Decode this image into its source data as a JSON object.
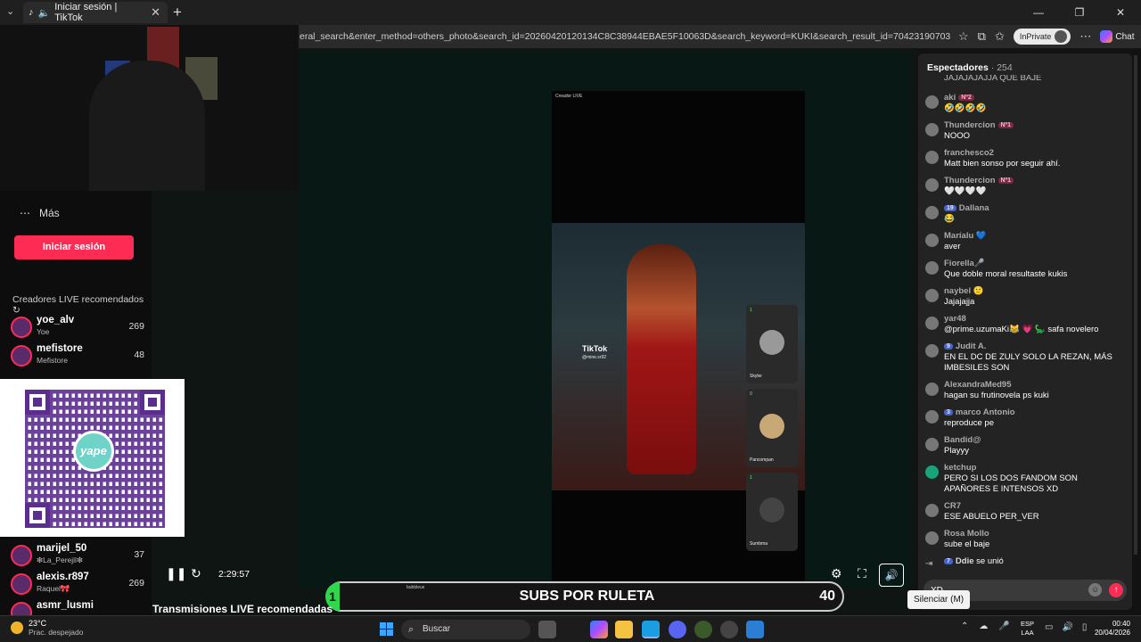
{
  "browser": {
    "tab_title": "Iniciar sesión | TikTok",
    "url": "eral_search&enter_method=others_photo&search_id=20260420120134C8C38944EBAE5F10063D&search_keyword=KUKI&search_result_id=7042319070368138246&search_typ...",
    "inprivate_label": "InPrivate",
    "chat_label": "Chat"
  },
  "nav": {
    "more_label": "Más",
    "login_label": "Iniciar sesión",
    "recommended_title": "Creadores LIVE recomendados",
    "creators": [
      {
        "name": "yoe_alv",
        "sub": "Yoe",
        "count": "269"
      },
      {
        "name": "mefistore",
        "sub": "Mefistore",
        "count": "48"
      },
      {
        "name": "marijel_50",
        "sub": "❇La_Perejil❇",
        "count": "37"
      },
      {
        "name": "alexis.r897",
        "sub": "Raquel🎀",
        "count": "269"
      },
      {
        "name": "asmr_lusmi",
        "sub": "",
        "count": ""
      }
    ]
  },
  "video": {
    "creator_live_label": "Creador LIVE",
    "tiktok_watermark": "TikTok",
    "watermark_handle": "@mine.sr92",
    "guests": [
      {
        "top_label": "1",
        "name": "Skyler"
      },
      {
        "top_label": "0",
        "name": "Pancompan"
      },
      {
        "top_label": "1",
        "name": "Sumbma"
      }
    ],
    "elapsed": "2:29:57",
    "mute_tooltip": "Silenciar (M)",
    "recommended_lives": "Transmisiones LIVE recomendadas"
  },
  "chat": {
    "title": "Espectadores",
    "viewer_count": "· 254",
    "messages": [
      {
        "user": "",
        "badge": "",
        "lvl": "",
        "text": "JAJAJAJAJJA QUE BAJE"
      },
      {
        "user": "aki",
        "badge": "Nº2",
        "lvl": "",
        "text": "🤣🤣🤣🤣"
      },
      {
        "user": "Thundercion",
        "badge": "Nº1",
        "lvl": "",
        "text": "NOOO"
      },
      {
        "user": "franchesco2",
        "badge": "",
        "lvl": "",
        "text": "Matt bien sonso por seguir ahí."
      },
      {
        "user": "Thundercion",
        "badge": "Nº1",
        "lvl": "",
        "text": "🤍🤍🤍🤍"
      },
      {
        "user": "Dallana",
        "badge": "",
        "lvl": "19",
        "text": "😂"
      },
      {
        "user": "Maríalu 💙",
        "badge": "",
        "lvl": "",
        "text": "aver"
      },
      {
        "user": "Fiorella🎤",
        "badge": "",
        "lvl": "",
        "text": "Que doble moral resultaste kukis"
      },
      {
        "user": "naybel 🙂",
        "badge": "",
        "lvl": "",
        "text": "Jajajajja"
      },
      {
        "user": "yar48",
        "badge": "",
        "lvl": "",
        "text": "@prime.uzumaKi😹 💗 🦕 safa novelero"
      },
      {
        "user": "Judit A.",
        "badge": "",
        "lvl": "9",
        "text": "EN EL DC DE ZULY SOLO LA REZAN, MÁS IMBESILES SON"
      },
      {
        "user": "AlexandraMed95",
        "badge": "",
        "lvl": "",
        "text": "hagan su frutinovela ps kuki"
      },
      {
        "user": "marco Antonio",
        "badge": "",
        "lvl": "3",
        "text": "reproduce pe"
      },
      {
        "user": "Bandid@",
        "badge": "",
        "lvl": "",
        "text": "Playyy"
      },
      {
        "user": "ketchup",
        "badge": "",
        "lvl": "",
        "text": "PERO SI LOS DOS FANDOM SON APAÑORES E INTENSOS XD"
      },
      {
        "user": "CR7",
        "badge": "",
        "lvl": "",
        "text": "ESE ABUELO PER_VER"
      },
      {
        "user": "Rosa Mollo",
        "badge": "",
        "lvl": "",
        "text": "sube el baje"
      }
    ],
    "join_user": "Ddie",
    "join_lvl": "7",
    "join_text": "se unió",
    "input_value": "XD"
  },
  "overlay": {
    "qr_brand": "yape",
    "roulette_left": "1",
    "roulette_label": "SUBS POR RULETA",
    "roulette_count": "40",
    "roulette_tiny": "bubbleus"
  },
  "taskbar": {
    "temp": "23°C",
    "weather": "Prac. despejado",
    "search_label": "Buscar",
    "lang1": "ESP",
    "lang2": "LAA",
    "time": "00:40",
    "date": "20/04/2026"
  }
}
